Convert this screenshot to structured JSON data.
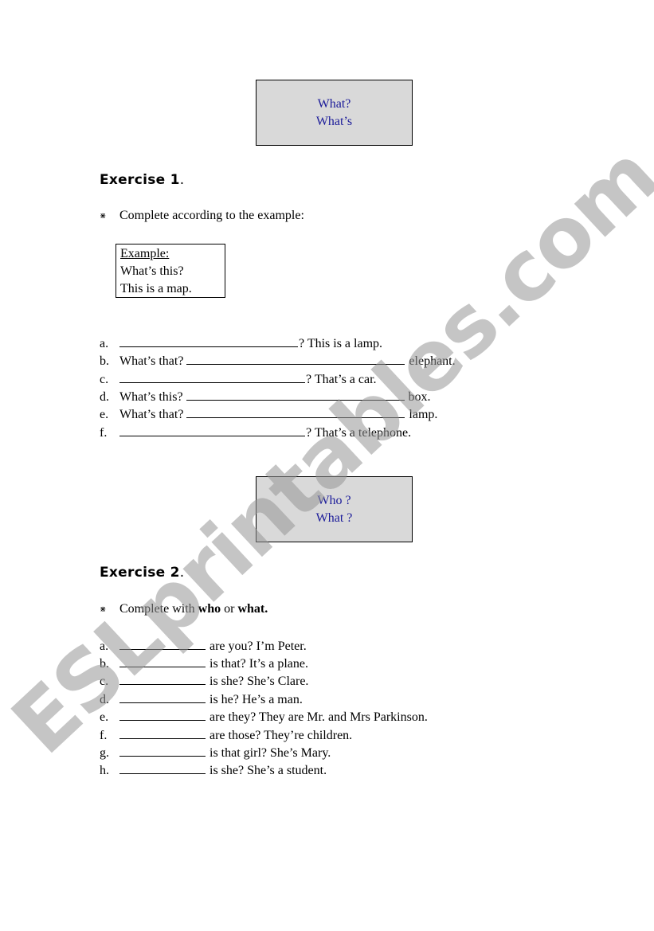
{
  "title_box_1": {
    "line1": "What?",
    "line2": "What’s"
  },
  "exercise1": {
    "heading": "Exercise 1",
    "heading_dot": ".",
    "bullet": "⋇",
    "instruction": "Complete according to the example:",
    "example": {
      "title": "Example:",
      "line1": "What’s this?",
      "line2": "This is a map."
    },
    "items": [
      {
        "letter": "a.",
        "before": "",
        "after": "? This is a lamp."
      },
      {
        "letter": "b.",
        "before": "What’s that? ",
        "after": " elephant."
      },
      {
        "letter": "c.",
        "before": "",
        "after": "? That’s a car."
      },
      {
        "letter": "d.",
        "before": "What’s this? ",
        "after": " box."
      },
      {
        "letter": "e.",
        "before": "What’s that? ",
        "after": " lamp."
      },
      {
        "letter": "f.",
        "before": "",
        "after": "? That’s a telephone."
      }
    ]
  },
  "title_box_2": {
    "line1": "Who ?",
    "line2": "What ?"
  },
  "exercise2": {
    "heading": "Exercise 2",
    "heading_dot": ".",
    "bullet": "⋇",
    "instruction_pre": "Complete with ",
    "instruction_who": "who",
    "instruction_or": " or ",
    "instruction_what": "what.",
    "items": [
      {
        "letter": "a.",
        "after": " are you? I’m Peter."
      },
      {
        "letter": "b.",
        "after": " is that? It’s a plane."
      },
      {
        "letter": "c.",
        "after": " is she? She’s Clare."
      },
      {
        "letter": "d.",
        "after": " is he? He’s a man."
      },
      {
        "letter": "e.",
        "after": " are they? They are Mr. and Mrs Parkinson."
      },
      {
        "letter": "f.",
        "after": " are those? They’re children."
      },
      {
        "letter": "g.",
        "after": " is that girl? She’s Mary."
      },
      {
        "letter": "h.",
        "after": " is she? She’s a student."
      }
    ]
  },
  "watermark": "ESLprintables.com",
  "colors": {
    "title_text": "#1a1a99",
    "title_box_bg": "#d9d9d9",
    "watermark": "#969696"
  }
}
